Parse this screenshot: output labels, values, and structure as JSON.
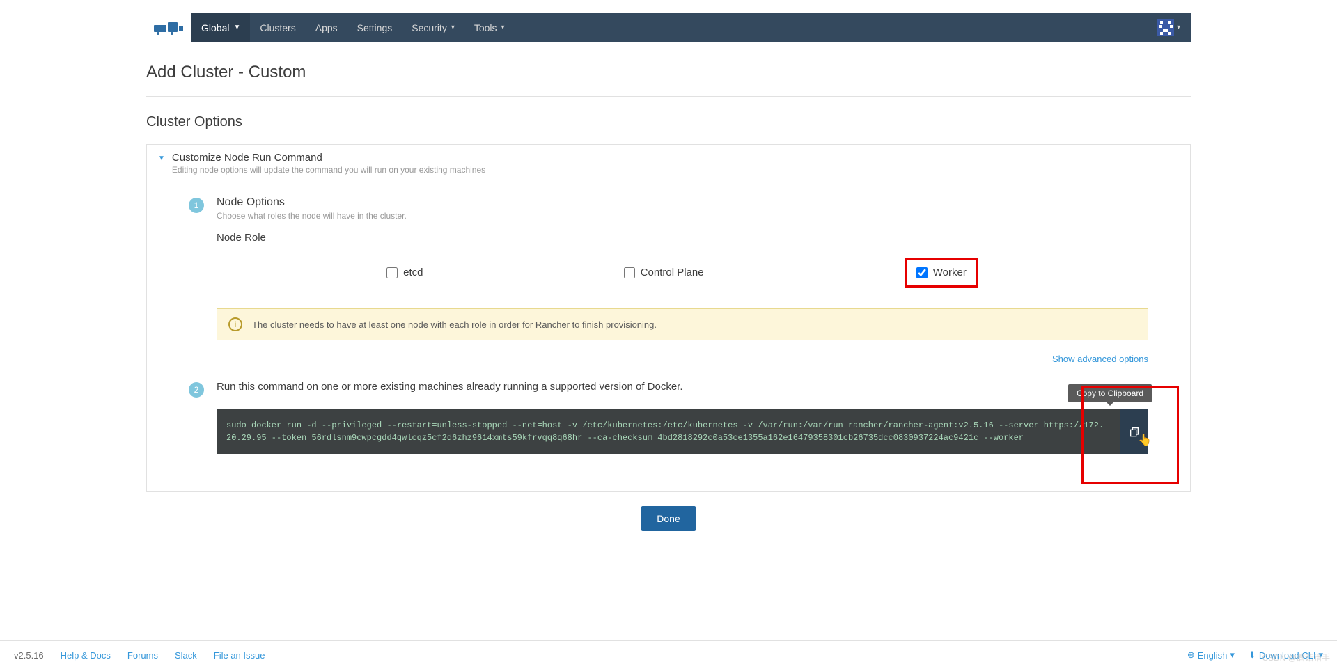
{
  "nav": {
    "global": "Global",
    "clusters": "Clusters",
    "apps": "Apps",
    "settings": "Settings",
    "security": "Security",
    "tools": "Tools"
  },
  "page": {
    "title": "Add Cluster - Custom",
    "section": "Cluster Options"
  },
  "panel": {
    "title": "Customize Node Run Command",
    "subtitle": "Editing node options will update the command you will run on your existing machines"
  },
  "step1": {
    "num": "1",
    "title": "Node Options",
    "sub": "Choose what roles the node will have in the cluster.",
    "role_label": "Node Role",
    "etcd": "etcd",
    "control_plane": "Control Plane",
    "worker": "Worker",
    "alert": "The cluster needs to have at least one node with each role in order for Rancher to finish provisioning.",
    "advanced": "Show advanced options"
  },
  "step2": {
    "num": "2",
    "text": "Run this command on one or more existing machines already running a supported version of Docker.",
    "command": "sudo docker run -d --privileged --restart=unless-stopped --net=host -v /etc/kubernetes:/etc/kubernetes -v /var/run:/var/run rancher/rancher-agent:v2.5.16 --server https://172.20.29.95 --token 56rdlsnm9cwpcgdd4qwlcqz5cf2d6zhz9614xmts59kfrvqq8q68hr --ca-checksum 4bd2818292c0a53ce1355a162e16479358301cb26735dcc0830937224ac9421c --worker",
    "tooltip": "Copy to Clipboard"
  },
  "done": "Done",
  "footer": {
    "version": "v2.5.16",
    "help": "Help & Docs",
    "forums": "Forums",
    "slack": "Slack",
    "issue": "File an Issue",
    "english": "English",
    "cli": "Download CLI"
  },
  "watermark": "CSDN @蘑菇猎手"
}
